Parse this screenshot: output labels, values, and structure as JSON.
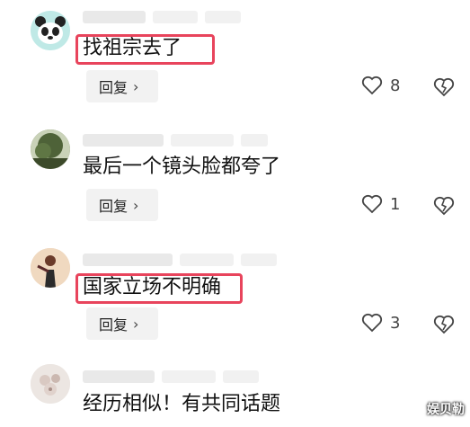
{
  "comments": [
    {
      "text": "找祖宗去了",
      "reply_label": "回复",
      "likes": "8",
      "highlighted": true,
      "avatar": "panda-avatar"
    },
    {
      "text": "最后一个镜头脸都夸了",
      "reply_label": "回复",
      "likes": "1",
      "highlighted": false,
      "avatar": "tree-avatar"
    },
    {
      "text": "国家立场不明确",
      "reply_label": "回复",
      "likes": "3",
      "highlighted": true,
      "avatar": "figure-avatar"
    },
    {
      "text": "经历相似！有共同话题",
      "reply_label": "回复",
      "likes": "",
      "highlighted": false,
      "avatar": "flower-avatar"
    }
  ],
  "watermark": "娱贝勒",
  "colors": {
    "highlight_border": "#e8445c",
    "reply_bg": "#f2f2f2"
  }
}
